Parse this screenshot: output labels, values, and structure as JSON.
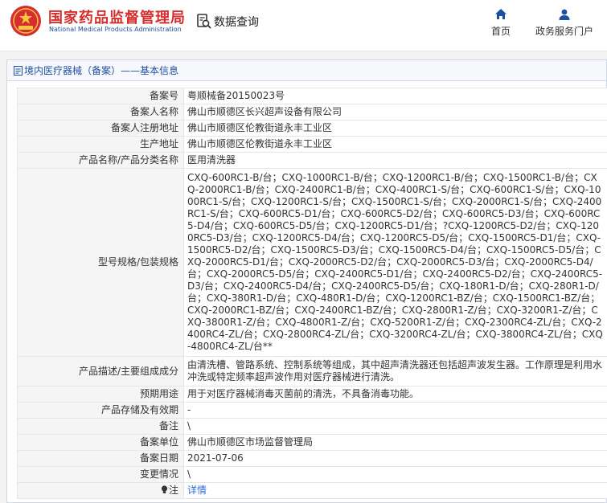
{
  "header": {
    "logo_cn": "国家药品监督管理局",
    "logo_en": "National Medical Products Administration",
    "search_label": "数据查询",
    "nav": [
      {
        "label": "首页",
        "icon": "home-icon"
      },
      {
        "label": "政务服务门户",
        "icon": "user-icon"
      }
    ]
  },
  "panel": {
    "title": "境内医疗器械（备案）——基本信息"
  },
  "rows": [
    {
      "label": "备案号",
      "value": "粤顺械备20150023号"
    },
    {
      "label": "备案人名称",
      "value": "佛山市顺德区长兴超声设备有限公司"
    },
    {
      "label": "备案人注册地址",
      "value": "佛山市顺德区伦教街道永丰工业区"
    },
    {
      "label": "生产地址",
      "value": "佛山市顺德区伦教街道永丰工业区"
    },
    {
      "label": "产品名称/产品分类名称",
      "value": "医用清洗器"
    },
    {
      "label": "型号规格/包装规格",
      "value": "CXQ-600RC1-B/台；CXQ-1000RC1-B/台；CXQ-1200RC1-B/台；CXQ-1500RC1-B/台；CXQ-2000RC1-B/台；CXQ-2400RC1-B/台；CXQ-400RC1-S/台；CXQ-600RC1-S/台；CXQ-1000RC1-S/台；CXQ-1200RC1-S/台；CXQ-1500RC1-S/台；CXQ-2000RC1-S/台；CXQ-2400RC1-S/台；CXQ-600RC5-D1/台；CXQ-600RC5-D2/台；CXQ-600RC5-D3/台；CXQ-600RC5-D4/台；CXQ-600RC5-D5/台；CXQ-1200RC5-D1/台；?CXQ-1200RC5-D2/台；CXQ-1200RC5-D3/台；CXQ-1200RC5-D4/台；CXQ-1200RC5-D5/台；CXQ-1500RC5-D1/台；CXQ-1500RC5-D2/台；CXQ-1500RC5-D3/台；CXQ-1500RC5-D4/台；CXQ-1500RC5-D5/台；CXQ-2000RC5-D1/台；CXQ-2000RC5-D2/台；CXQ-2000RC5-D3/台；CXQ-2000RC5-D4/台；CXQ-2000RC5-D5/台；CXQ-2400RC5-D1/台；CXQ-2400RC5-D2/台；CXQ-2400RC5-D3/台；CXQ-2400RC5-D4/台；CXQ-2400RC5-D5/台；CXQ-180R1-D/台；CXQ-280R1-D/台；CXQ-380R1-D/台；CXQ-480R1-D/台；CXQ-1200RC1-BZ/台；CXQ-1500RC1-BZ/台；CXQ-2000RC1-BZ/台；CXQ-2400RC1-BZ/台；CXQ-2800R1-Z/台；CXQ-3200R1-Z/台；CXQ-3800R1-Z/台；CXQ-4800R1-Z/台；CXQ-5200R1-Z/台；CXQ-2300RC4-ZL/台；CXQ-2400RC4-ZL/台；CXQ-2800RC4-ZL/台；CXQ-3200RC4-ZL/台；CXQ-3800RC4-ZL/台；CXQ-4800RC4-ZL/台**"
    },
    {
      "label": "产品描述/主要组成成分",
      "value": "由清洗槽、管路系统、控制系统等组成，其中超声清洗器还包括超声波发生器。工作原理是利用水冲洗或特定频率超声波作用对医疗器械进行清洗。"
    },
    {
      "label": "预期用途",
      "value": "用于对医疗器械消毒灭菌前的清洗，不具备消毒功能。"
    },
    {
      "label": "产品存储及有效期",
      "value": "-"
    },
    {
      "label": "备注",
      "value": "\\"
    },
    {
      "label": "备案单位",
      "value": "佛山市顺德区市场监督管理局"
    },
    {
      "label": "备案日期",
      "value": "2021-07-06"
    },
    {
      "label": "变更情况",
      "value": "\\"
    }
  ],
  "note_row": {
    "label": "注",
    "link": "详情",
    "icon": "lightbulb-icon"
  },
  "colors": {
    "brand_red": "#d62e2e",
    "brand_blue": "#1f4fa3",
    "link_blue": "#2b6cd0"
  }
}
